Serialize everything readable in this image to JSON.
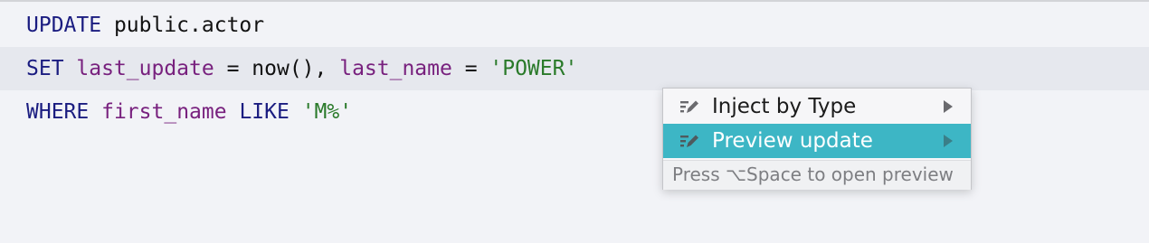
{
  "editor": {
    "lines": [
      {
        "tokens": [
          {
            "text": "UPDATE",
            "kind": "kw"
          },
          {
            "text": " public.actor",
            "kind": "ident"
          }
        ]
      },
      {
        "tokens": [
          {
            "text": "SET",
            "kind": "kw"
          },
          {
            "text": " ",
            "kind": "punct"
          },
          {
            "text": "last_update",
            "kind": "col"
          },
          {
            "text": " = now(), ",
            "kind": "punct"
          },
          {
            "text": "last_name",
            "kind": "col"
          },
          {
            "text": " = ",
            "kind": "punct"
          },
          {
            "text": "'POWER'",
            "kind": "str"
          }
        ]
      },
      {
        "tokens": [
          {
            "text": "WHERE",
            "kind": "kw"
          },
          {
            "text": " ",
            "kind": "punct"
          },
          {
            "text": "first_name",
            "kind": "col"
          },
          {
            "text": " ",
            "kind": "punct"
          },
          {
            "text": "LIKE",
            "kind": "kw"
          },
          {
            "text": " ",
            "kind": "punct"
          },
          {
            "text": "'M%'",
            "kind": "str"
          }
        ]
      }
    ]
  },
  "popup": {
    "items": [
      {
        "label": "Inject by Type",
        "icon": "pencil-edit-icon",
        "has_submenu": true,
        "selected": false
      },
      {
        "label": "Preview update",
        "icon": "pencil-edit-icon",
        "has_submenu": true,
        "selected": true
      }
    ],
    "hint": "Press ⌥Space to open preview"
  },
  "colors": {
    "editor_background": "#f2f3f7",
    "current_line_highlight": "#e6e8ee",
    "keyword": "#1a1c80",
    "column": "#78217e",
    "string": "#2a7a2a",
    "selection": "#3db6c5"
  }
}
